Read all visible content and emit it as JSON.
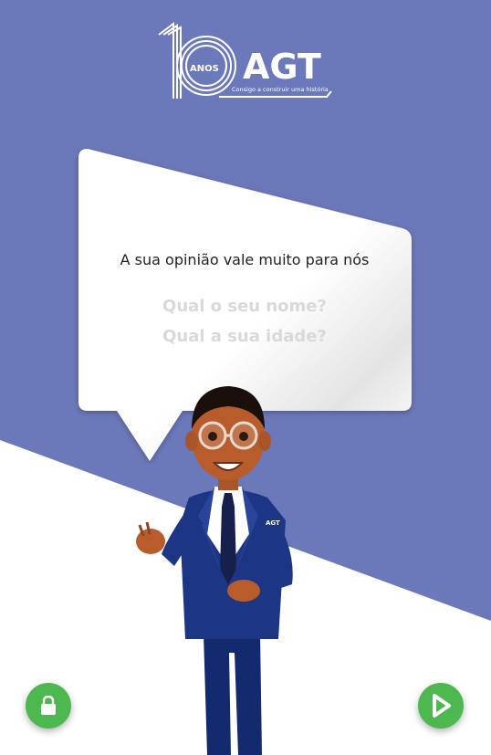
{
  "logo": {
    "anos": "ANOS",
    "brand": "AGT",
    "tagline": "Consigo a construir uma história"
  },
  "bubble": {
    "message": "A sua opinião vale muito para nós",
    "questions": [
      "Qual o seu nome?",
      "Qual a sua idade?"
    ]
  },
  "avatar": {
    "badge": "AGT"
  },
  "colors": {
    "background_accent": "#6b78b9",
    "button_green": "#4cb84f",
    "suit_blue": "#1d3585"
  },
  "buttons": {
    "lock_icon": "lock-icon",
    "play_icon": "play-icon"
  }
}
